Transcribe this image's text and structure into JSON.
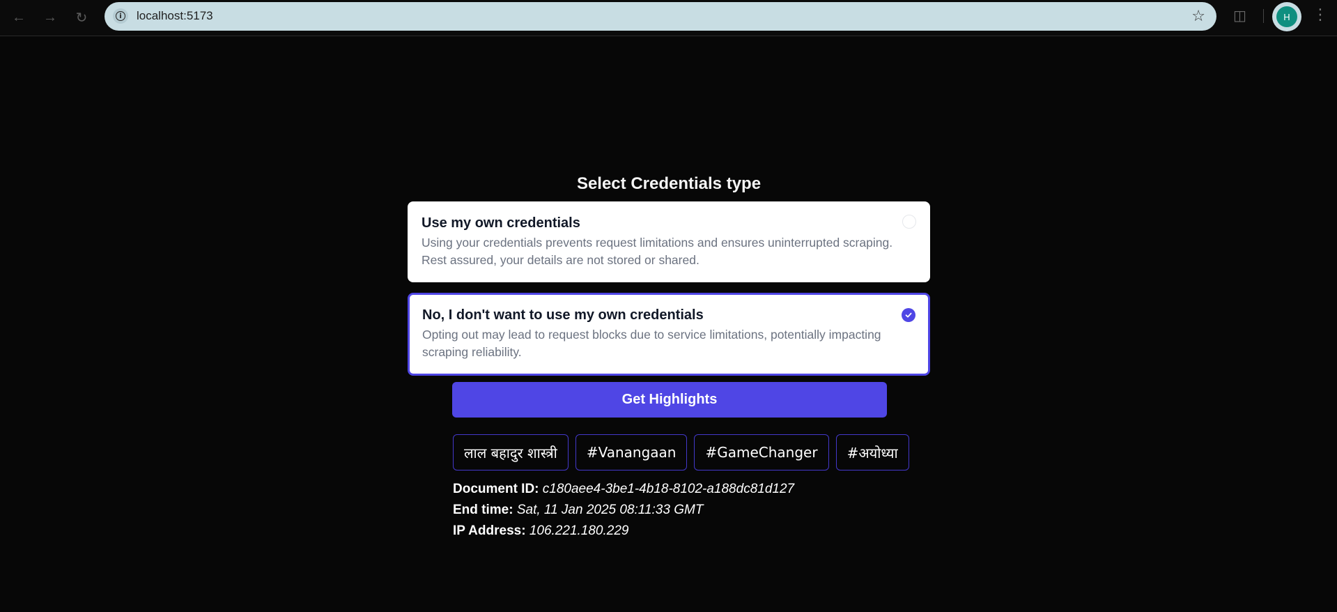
{
  "browser": {
    "url": "localhost:5173",
    "profile_initial": "H"
  },
  "page": {
    "heading": "Select Credentials type",
    "options": [
      {
        "title": "Use my own credentials",
        "description": "Using your credentials prevents request limitations and ensures uninterrupted scraping. Rest assured, your details are not stored or shared.",
        "selected": false
      },
      {
        "title": "No, I don't want to use my own credentials",
        "description": "Opting out may lead to request blocks due to service limitations, potentially impacting scraping reliability.",
        "selected": true
      }
    ],
    "button_label": "Get Highlights",
    "tags": [
      "लाल बहादुर शास्त्री",
      "#Vanangaan",
      "#GameChanger",
      "#अयोध्या"
    ],
    "meta": {
      "document_id_label": "Document ID:",
      "document_id": "c180aee4-3be1-4b18-8102-a188dc81d127",
      "end_time_label": "End time:",
      "end_time": "Sat, 11 Jan 2025 08:11:33 GMT",
      "ip_label": "IP Address:",
      "ip": "106.221.180.229"
    }
  },
  "colors": {
    "accent": "#4f46e5",
    "background": "#070707",
    "tag_border": "#4338ca"
  },
  "icons": [
    "back-arrow-icon",
    "forward-arrow-icon",
    "reload-icon",
    "site-info-icon",
    "bookmark-star-icon",
    "extensions-icon",
    "kebab-menu-icon",
    "check-icon"
  ]
}
